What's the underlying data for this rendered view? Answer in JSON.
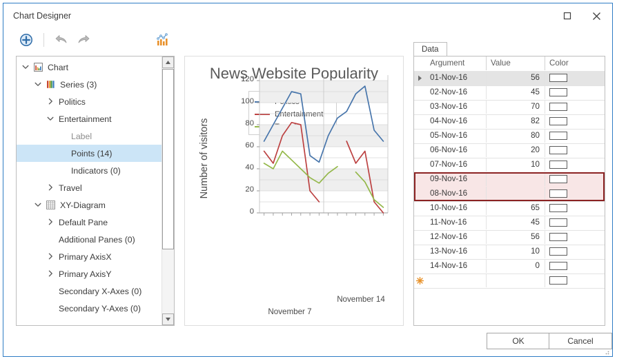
{
  "window": {
    "title": "Chart Designer",
    "maximize_icon": "maximize-icon",
    "close_icon": "close-icon"
  },
  "toolbar": {
    "add_icon": "add-circle-icon",
    "undo_icon": "undo-arrow-icon",
    "redo_icon": "redo-arrow-icon",
    "wizard_icon": "chart-wizard-icon"
  },
  "tree": {
    "items": [
      {
        "label": "Chart",
        "indent": 0,
        "chevron": "down",
        "icon": "chart-bars-icon",
        "state": "normal"
      },
      {
        "label": "Series (3)",
        "indent": 1,
        "chevron": "down",
        "icon": "series-bars-icon",
        "state": "normal"
      },
      {
        "label": "Politics",
        "indent": 2,
        "chevron": "right",
        "icon": "none",
        "state": "normal"
      },
      {
        "label": "Entertainment",
        "indent": 2,
        "chevron": "down",
        "icon": "none",
        "state": "normal"
      },
      {
        "label": "Label",
        "indent": 3,
        "chevron": "none",
        "icon": "none",
        "state": "dim"
      },
      {
        "label": "Points (14)",
        "indent": 3,
        "chevron": "none",
        "icon": "none",
        "state": "selected"
      },
      {
        "label": "Indicators (0)",
        "indent": 3,
        "chevron": "none",
        "icon": "none",
        "state": "normal"
      },
      {
        "label": "Travel",
        "indent": 2,
        "chevron": "right",
        "icon": "none",
        "state": "normal"
      },
      {
        "label": "XY-Diagram",
        "indent": 1,
        "chevron": "down",
        "icon": "grid-icon",
        "state": "normal"
      },
      {
        "label": "Default Pane",
        "indent": 2,
        "chevron": "right",
        "icon": "none",
        "state": "normal"
      },
      {
        "label": "Additional Panes (0)",
        "indent": 2,
        "chevron": "none",
        "icon": "none",
        "state": "normal"
      },
      {
        "label": "Primary AxisX",
        "indent": 2,
        "chevron": "right",
        "icon": "none",
        "state": "normal"
      },
      {
        "label": "Primary AxisY",
        "indent": 2,
        "chevron": "right",
        "icon": "none",
        "state": "normal"
      },
      {
        "label": "Secondary X-Axes (0)",
        "indent": 2,
        "chevron": "none",
        "icon": "none",
        "state": "normal"
      },
      {
        "label": "Secondary Y-Axes (0)",
        "indent": 2,
        "chevron": "none",
        "icon": "none",
        "state": "normal"
      }
    ],
    "scroll_up_icon": "scroll-up-icon",
    "scroll_down_icon": "scroll-down-icon"
  },
  "chart_data": {
    "type": "line",
    "title": "News Website Popularity",
    "xlabel": "",
    "ylabel": "Number of visitors",
    "ylim": [
      0,
      125
    ],
    "yticks": [
      0,
      20,
      40,
      60,
      80,
      100,
      120
    ],
    "grid": true,
    "legend_position": "top-center",
    "x_tick_labels": [
      "November 7",
      "November 14"
    ],
    "categories": [
      "01-Nov-16",
      "02-Nov-16",
      "03-Nov-16",
      "04-Nov-16",
      "05-Nov-16",
      "06-Nov-16",
      "07-Nov-16",
      "08-Nov-16",
      "09-Nov-16",
      "10-Nov-16",
      "11-Nov-16",
      "12-Nov-16",
      "13-Nov-16",
      "14-Nov-16"
    ],
    "series": [
      {
        "name": "Politics",
        "color": "#4775ab",
        "values": [
          65,
          80,
          95,
          110,
          108,
          52,
          46,
          70,
          86,
          92,
          108,
          115,
          75,
          65
        ]
      },
      {
        "name": "Entertainment",
        "color": "#bc4141",
        "values": [
          56,
          45,
          70,
          82,
          80,
          20,
          10,
          null,
          null,
          65,
          45,
          56,
          10,
          0
        ]
      },
      {
        "name": "Travel",
        "color": "#94b84a",
        "values": [
          45,
          40,
          56,
          48,
          40,
          32,
          27,
          36,
          42,
          null,
          37,
          28,
          12,
          5
        ]
      }
    ]
  },
  "grid_panel": {
    "tab_label": "Data",
    "columns": [
      "Argument",
      "Value",
      "Color"
    ],
    "rows": [
      {
        "argument": "01-Nov-16",
        "value": "56",
        "state": "current"
      },
      {
        "argument": "02-Nov-16",
        "value": "45",
        "state": "normal"
      },
      {
        "argument": "03-Nov-16",
        "value": "70",
        "state": "normal"
      },
      {
        "argument": "04-Nov-16",
        "value": "82",
        "state": "normal"
      },
      {
        "argument": "05-Nov-16",
        "value": "80",
        "state": "normal"
      },
      {
        "argument": "06-Nov-16",
        "value": "20",
        "state": "normal"
      },
      {
        "argument": "07-Nov-16",
        "value": "10",
        "state": "normal"
      },
      {
        "argument": "09-Nov-16",
        "value": "",
        "state": "error"
      },
      {
        "argument": "08-Nov-16",
        "value": "",
        "state": "error"
      },
      {
        "argument": "10-Nov-16",
        "value": "65",
        "state": "normal"
      },
      {
        "argument": "11-Nov-16",
        "value": "45",
        "state": "normal"
      },
      {
        "argument": "12-Nov-16",
        "value": "56",
        "state": "normal"
      },
      {
        "argument": "13-Nov-16",
        "value": "10",
        "state": "normal"
      },
      {
        "argument": "14-Nov-16",
        "value": "0",
        "state": "normal"
      },
      {
        "argument": "",
        "value": "",
        "state": "new"
      }
    ],
    "new_row_icon": "new-row-star-icon",
    "current_row_icon": "current-row-arrow-icon",
    "swatch_icon": "color-swatch-icon"
  },
  "footer": {
    "ok_label": "OK",
    "cancel_label": "Cancel",
    "resize_icon": "resize-grip-icon"
  },
  "colors": {
    "accent": "#2e7cc4",
    "selection": "#cce5f7",
    "error_border": "#8b2222",
    "error_fill": "#f8e6e6",
    "band": "#efefef"
  }
}
